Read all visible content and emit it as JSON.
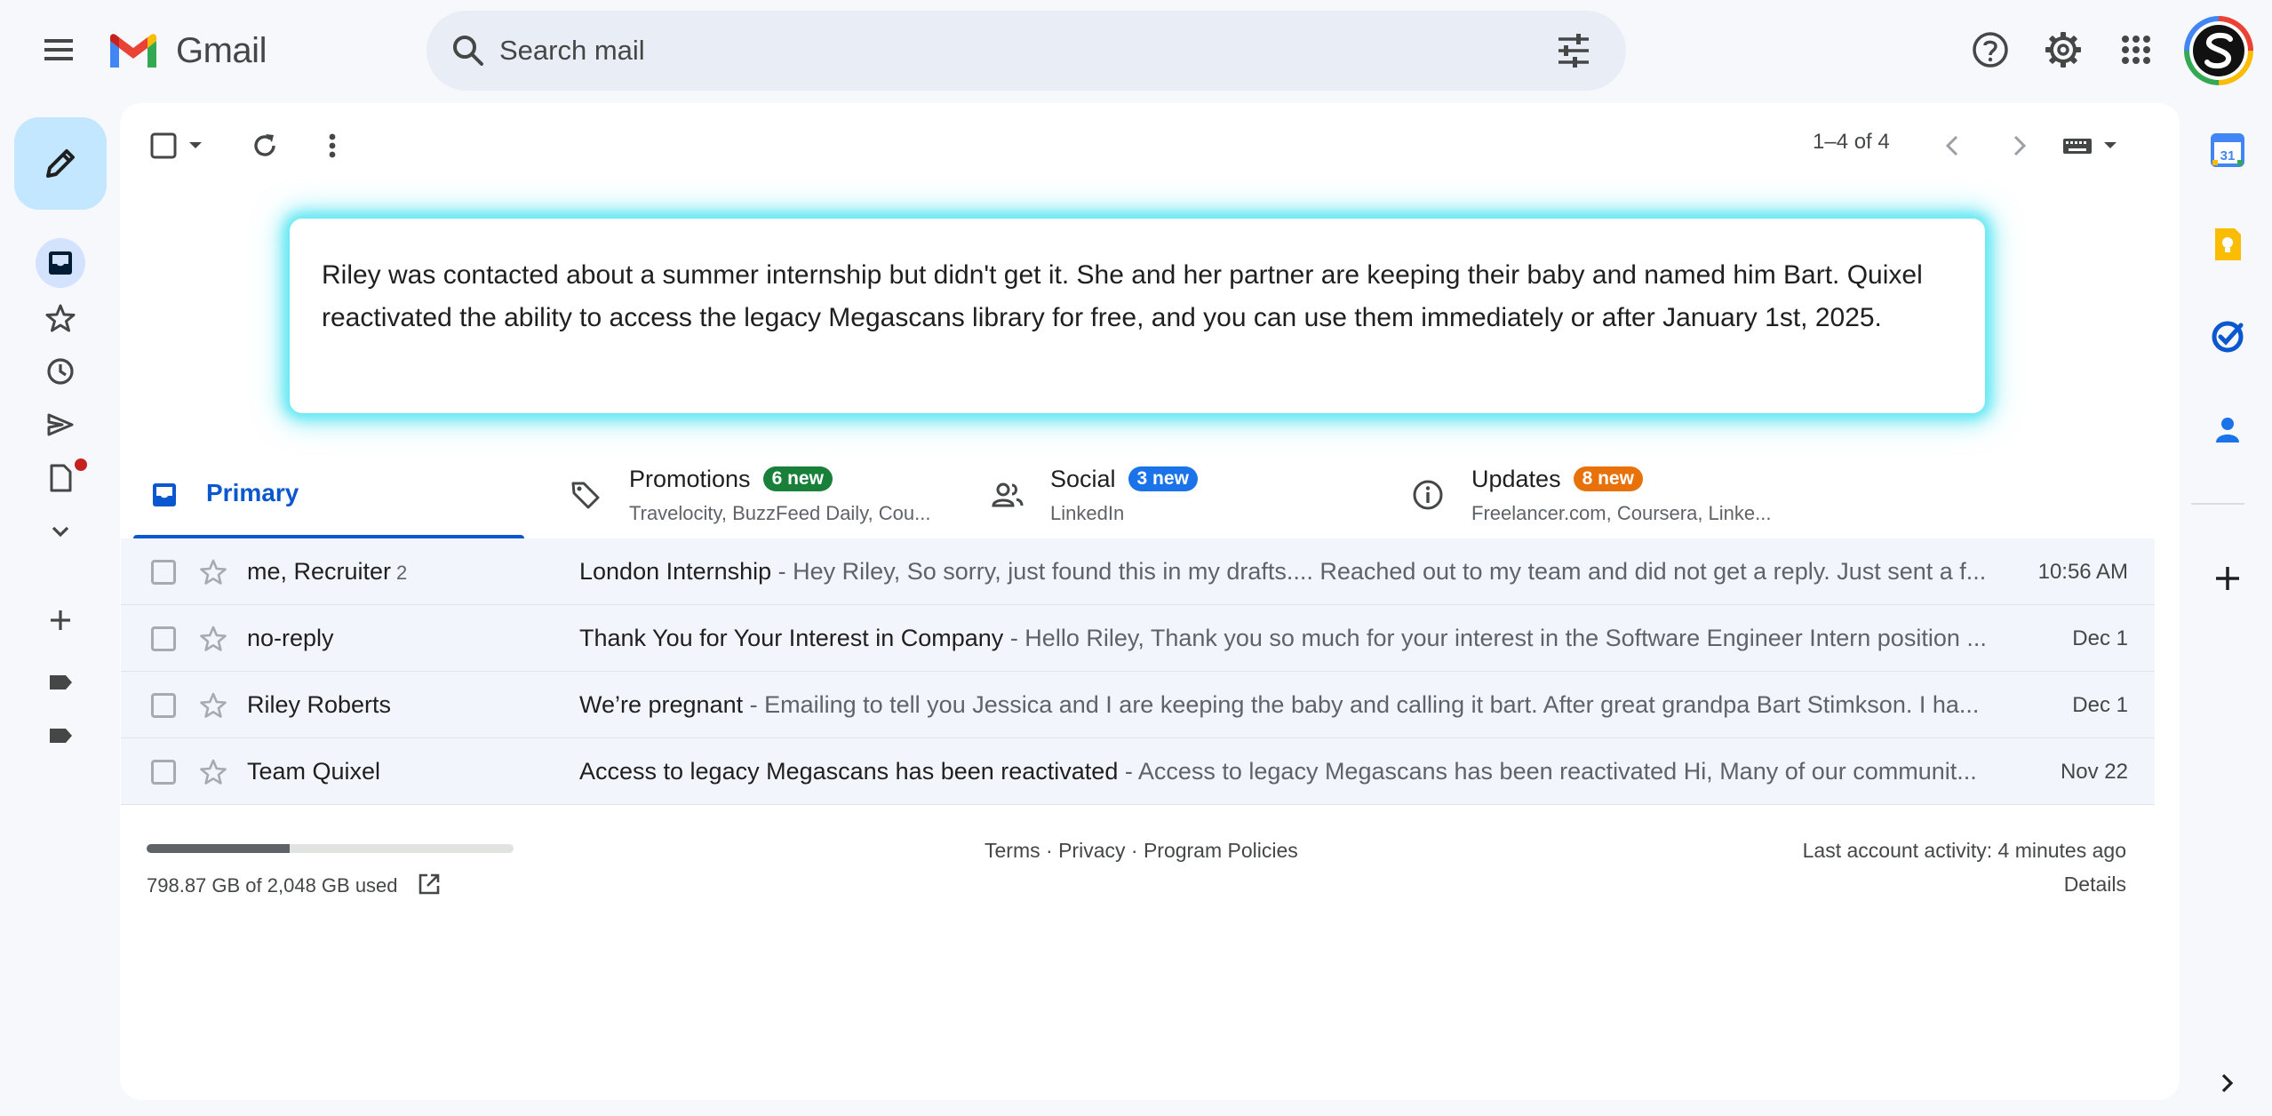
{
  "app": {
    "name": "Gmail"
  },
  "header": {
    "search_placeholder": "Search mail",
    "icons": [
      "menu-icon",
      "search-icon",
      "tune-icon",
      "help-icon",
      "settings-icon",
      "apps-icon"
    ]
  },
  "toolbar": {
    "count_label": "1–4 of 4"
  },
  "summary": {
    "text": "Riley was contacted about a summer internship but didn't get it. She and her partner are keeping their baby and named him Bart. Quixel reactivated the ability to access the legacy Megascans library for free, and you can use them immediately or after January 1st, 2025."
  },
  "tabs": [
    {
      "title": "Primary",
      "active": true
    },
    {
      "title": "Promotions",
      "badge": "6 new",
      "badge_color": "#188038",
      "subtitle": "Travelocity, BuzzFeed Daily, Cou..."
    },
    {
      "title": "Social",
      "badge": "3 new",
      "badge_color": "#1a73e8",
      "subtitle": "LinkedIn"
    },
    {
      "title": "Updates",
      "badge": "8 new",
      "badge_color": "#e8710a",
      "subtitle": "Freelancer.com, Coursera, Linke..."
    }
  ],
  "emails": [
    {
      "sender": "me, Recruiter",
      "count": "2",
      "subject": "London Internship",
      "snippet": " - Hey Riley, So sorry, just found this in my drafts.... Reached out to my team and did not get a reply. Just sent a f...",
      "date": "10:56 AM"
    },
    {
      "sender": "no-reply",
      "count": "",
      "subject": "Thank You for Your Interest in Company",
      "snippet": " - Hello Riley, Thank you so much for your interest in the Software Engineer Intern position ...",
      "date": "Dec 1"
    },
    {
      "sender": "Riley Roberts",
      "count": "",
      "subject": "We’re pregnant",
      "snippet": " - Emailing to tell you Jessica and I are keeping the baby and calling it bart. After great grandpa Bart Stimkson. I ha...",
      "date": "Dec 1"
    },
    {
      "sender": "Team Quixel",
      "count": "",
      "subject": "Access to legacy Megascans has been reactivated",
      "snippet": " - Access to legacy Megascans has been reactivated Hi, Many of our communit...",
      "date": "Nov 22"
    }
  ],
  "footer": {
    "storage_text": "798.87 GB of 2,048 GB used",
    "storage_fraction": 0.39,
    "links": [
      "Terms",
      "Privacy",
      "Program Policies"
    ],
    "link_separator": " · ",
    "last_activity": "Last account activity: 4 minutes ago",
    "details": "Details"
  },
  "side_panel": {
    "calendar_date": "31"
  },
  "colors": {
    "accent": "#0b57d0",
    "compose_bg": "#c2e7ff",
    "row_bg": "#f2f6fc"
  }
}
